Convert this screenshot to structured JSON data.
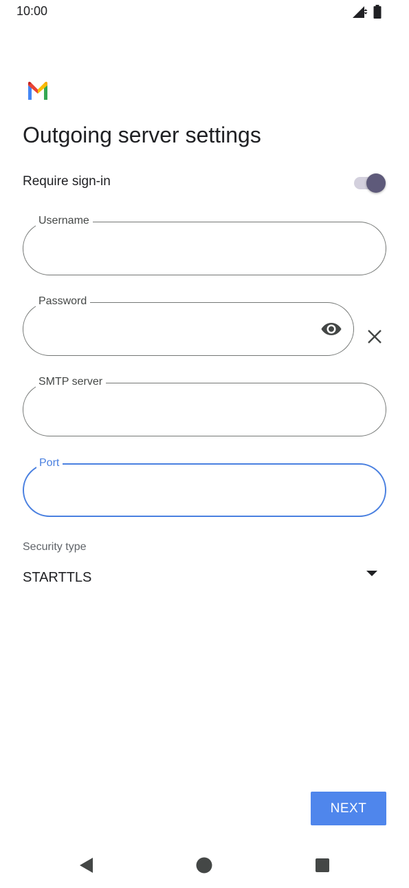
{
  "status_bar": {
    "time": "10:00",
    "signal_icon": "cellular-signal-icon",
    "battery_icon": "battery-icon"
  },
  "app": {
    "logo_icon": "gmail-logo"
  },
  "page": {
    "title": "Outgoing server settings"
  },
  "require_signin": {
    "label": "Require sign-in",
    "enabled": true
  },
  "fields": {
    "username": {
      "label": "Username",
      "value": ""
    },
    "password": {
      "label": "Password",
      "value": ""
    },
    "smtp_server": {
      "label": "SMTP server",
      "value": ""
    },
    "port": {
      "label": "Port",
      "value": "",
      "focused": true
    }
  },
  "security": {
    "label": "Security type",
    "selected": "STARTTLS"
  },
  "actions": {
    "next_label": "NEXT"
  },
  "nav": {
    "back_icon": "back-triangle-icon",
    "home_icon": "home-circle-icon",
    "recents_icon": "recents-square-icon"
  },
  "colors": {
    "accent": "#4a80e0",
    "button": "#4f86ec",
    "toggle_thumb": "#5e5a7a",
    "toggle_track": "#d3d0dd",
    "outline": "#747775"
  }
}
